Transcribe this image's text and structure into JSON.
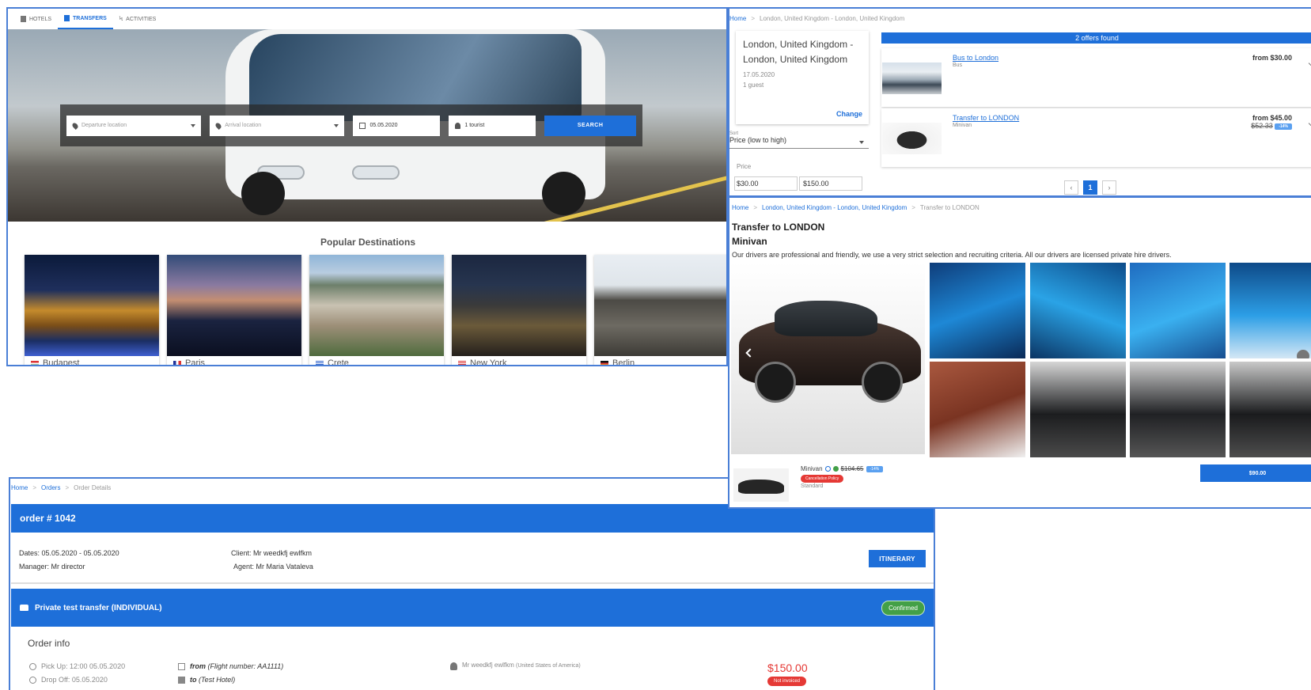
{
  "search": {
    "tabs": [
      "HOTELS",
      "TRANSFERS",
      "ACTIVITIES"
    ],
    "departure_placeholder": "Departure location",
    "arrival_placeholder": "Arrival location",
    "date": "05.05.2020",
    "tourists": "1 tourist",
    "search_button": "SEARCH",
    "popular_title": "Popular Destinations",
    "destinations": [
      "Budapest",
      "Paris",
      "Crete",
      "New York",
      "Berlin"
    ]
  },
  "results": {
    "breadcrumb": {
      "home": "Home",
      "current": "London, United Kingdom - London, United Kingdom"
    },
    "card": {
      "title": "London, United Kingdom - London, United Kingdom",
      "date": "17.05.2020",
      "guests": "1 guest",
      "change": "Change"
    },
    "offers_found": "2 offers found",
    "offers": [
      {
        "title": "Bus to London",
        "type": "Bus",
        "price": "from $30.00",
        "old_price": "",
        "discount": ""
      },
      {
        "title": "Transfer to LONDON",
        "type": "Minivan",
        "price": "from $45.00",
        "old_price": "$52.33",
        "discount": "-14%"
      }
    ],
    "sort_label": "Sort",
    "sort_value": "Price (low to high)",
    "price_label": "Price",
    "price_min": "$30.00",
    "price_max": "$150.00",
    "page": "1"
  },
  "details": {
    "breadcrumb": {
      "home": "Home",
      "search": "London, United Kingdom - London, United Kingdom",
      "current": "Transfer to LONDON"
    },
    "title": "Transfer to LONDON",
    "subtitle": "Minivan",
    "description": "Our drivers are professional and friendly, we use a very strict selection and recruiting criteria. All our drivers are licensed private hire drivers.",
    "variant": {
      "name": "Minivan",
      "old_price": "$104.65",
      "discount": "-14%",
      "policy": "Cancellation Policy",
      "category": "Standard",
      "button": "$90.00"
    }
  },
  "order": {
    "breadcrumb": {
      "home": "Home",
      "orders": "Orders",
      "current": "Order Details"
    },
    "title": "order # 1042",
    "dates": "Dates: 05.05.2020 - 05.05.2020",
    "manager": "Manager: Mr director",
    "client": "Client: Mr weedkfj ewlfkm",
    "agent": "Agent: Mr Maria Vataleva",
    "itinerary": "ITINERARY",
    "service": "Private test transfer (INDIVIDUAL)",
    "status": "Confirmed",
    "info_title": "Order info",
    "pickup": "Pick Up: 12:00 05.05.2020",
    "dropoff": "Drop Off: 05.05.2020",
    "from": "from",
    "from_detail": "(Flight number: AA1111)",
    "to": "to",
    "to_detail": "(Test Hotel)",
    "passenger": "Mr weedkfj ewlfkm",
    "passenger_country": "(United States of America)",
    "amount": "$150.00",
    "invoice_status": "Not invoiced"
  },
  "colors": {
    "accent": "#1e6fd9",
    "confirmed": "#43a047",
    "alert": "#e53935",
    "panel_border": "#4a7fd6"
  }
}
